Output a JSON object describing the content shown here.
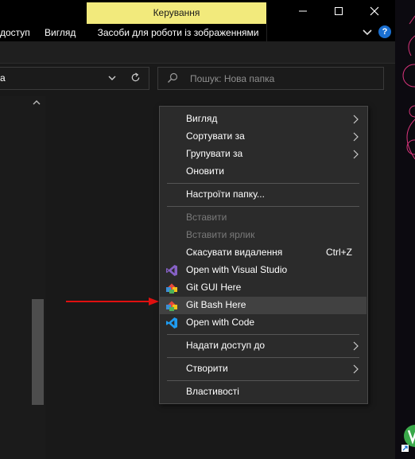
{
  "titlebar": {
    "contextual_tab": "Керування"
  },
  "ribbon": {
    "tabs": [
      "доступ",
      "Вигляд",
      "Засоби для роботи із зображеннями"
    ],
    "help": "?"
  },
  "address": {
    "text": "а"
  },
  "search": {
    "placeholder": "Пошук: Нова папка"
  },
  "menu": {
    "items": [
      {
        "label": "Вигляд",
        "submenu": true
      },
      {
        "label": "Сортувати за",
        "submenu": true
      },
      {
        "label": "Групувати за",
        "submenu": true
      },
      {
        "label": "Оновити"
      },
      {
        "label": "Настроїти папку..."
      },
      {
        "label": "Вставити",
        "disabled": true
      },
      {
        "label": "Вставити ярлик",
        "disabled": true
      },
      {
        "label": "Скасувати видалення",
        "shortcut": "Ctrl+Z"
      },
      {
        "label": "Open with Visual Studio",
        "icon": "visual-studio-icon"
      },
      {
        "label": "Git GUI Here",
        "icon": "git-gui-icon"
      },
      {
        "label": "Git Bash Here",
        "icon": "git-bash-icon",
        "highlighted": true
      },
      {
        "label": "Open with Code",
        "icon": "vscode-icon"
      },
      {
        "label": "Надати доступ до",
        "submenu": true
      },
      {
        "label": "Створити",
        "submenu": true
      },
      {
        "label": "Властивості"
      }
    ]
  },
  "colors": {
    "contextual_tab_bg": "#f2ea7c",
    "menu_bg": "#2b2b2b",
    "highlight_bg": "#414141",
    "annotation_arrow": "#e01010"
  }
}
